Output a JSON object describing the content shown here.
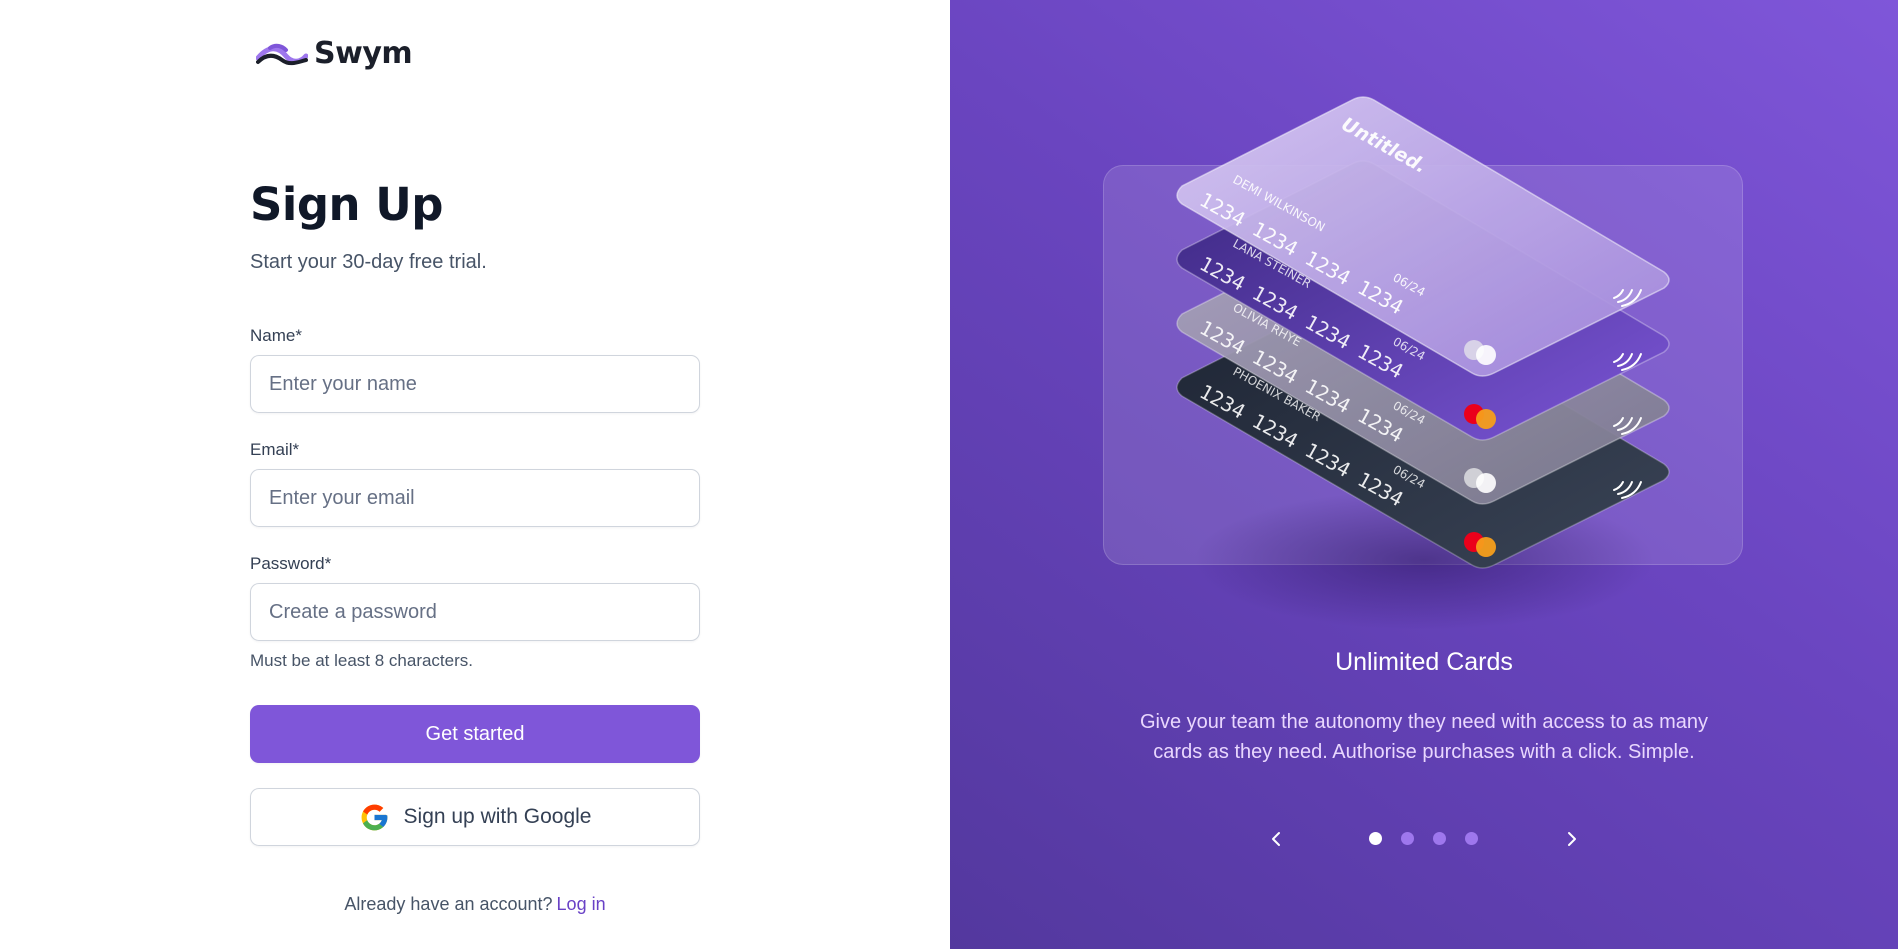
{
  "brand": {
    "name": "Swym",
    "accent": "#7f56d9",
    "accent_dark": "#6941c6"
  },
  "signup": {
    "title": "Sign Up",
    "subtitle": "Start your 30-day free trial.",
    "fields": {
      "name": {
        "label": "Name*",
        "placeholder": "Enter your name",
        "value": ""
      },
      "email": {
        "label": "Email*",
        "placeholder": "Enter your email",
        "value": ""
      },
      "password": {
        "label": "Password*",
        "placeholder": "Create a password",
        "value": "",
        "hint": "Must be at least 8 characters."
      }
    },
    "primary_button": "Get started",
    "google_button": "Sign up with Google",
    "footer": {
      "prompt": "Already have an account?",
      "link": "Log in"
    }
  },
  "showcase": {
    "cards": [
      {
        "brand": "Untitled.",
        "holder": "DEMI WILKINSON",
        "number": "1234 1234 1234 1234",
        "expiry": "06/24",
        "theme": "glass"
      },
      {
        "holder": "LANA STEINER",
        "number": "1234 1234 1234 1234",
        "expiry": "06/24",
        "theme": "purple"
      },
      {
        "holder": "OLIVIA RHYE",
        "number": "1234 1234 1234 1234",
        "expiry": "06/24",
        "theme": "gray"
      },
      {
        "holder": "PHOENIX BAKER",
        "number": "1234 1234 1234 1234",
        "expiry": "06/24",
        "theme": "dark"
      }
    ],
    "title": "Unlimited Cards",
    "description": "Give your team the autonomy they need with access to as many cards as they need. Authorise purchases with a click. Simple.",
    "carousel": {
      "slides": 4,
      "active_index": 0
    }
  },
  "icons": {
    "logo": "swym-logo-icon",
    "google": "google-icon",
    "prev": "chevron-left-icon",
    "next": "chevron-right-icon",
    "contactless": "contactless-icon"
  }
}
